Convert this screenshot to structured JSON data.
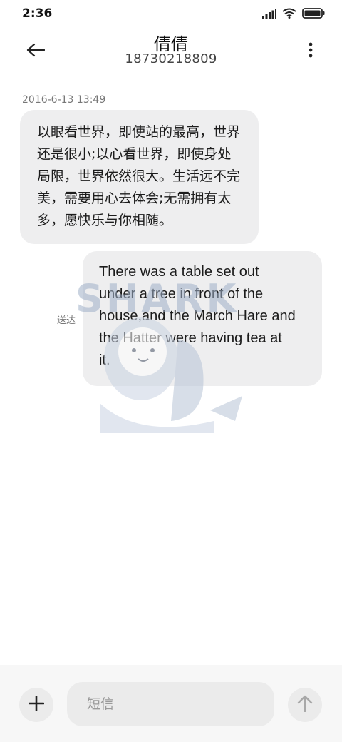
{
  "status_bar": {
    "time": "2:36",
    "icons": [
      "signal-icon",
      "wifi-icon",
      "battery-icon"
    ]
  },
  "header": {
    "contact_name": "倩倩",
    "contact_number": "18730218809",
    "back_icon": "back-arrow-icon",
    "more_icon": "more-vertical-icon"
  },
  "conversation": {
    "timestamp": "2016-6-13 13:49",
    "messages": [
      {
        "direction": "incoming",
        "lines": [
          "以眼看世界，即使站的最高，世界",
          "还是很小;以心看世界，即使身处",
          "局限，世界依然很大。生活远不完",
          "美，需要用心去体会;无需拥有太",
          "多，愿快乐与你相随。"
        ]
      },
      {
        "direction": "outgoing",
        "status": "送达",
        "lines": [
          "There was a table set out",
          "under a tree in front of the",
          "house,and the March Hare and",
          "the Hatter were having tea at",
          "it."
        ]
      }
    ]
  },
  "watermark": {
    "text": "SHARK"
  },
  "composer": {
    "attach_icon": "plus-icon",
    "input_placeholder": "短信",
    "input_value": "",
    "send_icon": "send-arrow-up-icon"
  },
  "colors": {
    "bubble": "#eeeeef",
    "composer_bg": "#f7f7f7",
    "button_bg": "#ebebeb",
    "muted_text": "#777777"
  }
}
